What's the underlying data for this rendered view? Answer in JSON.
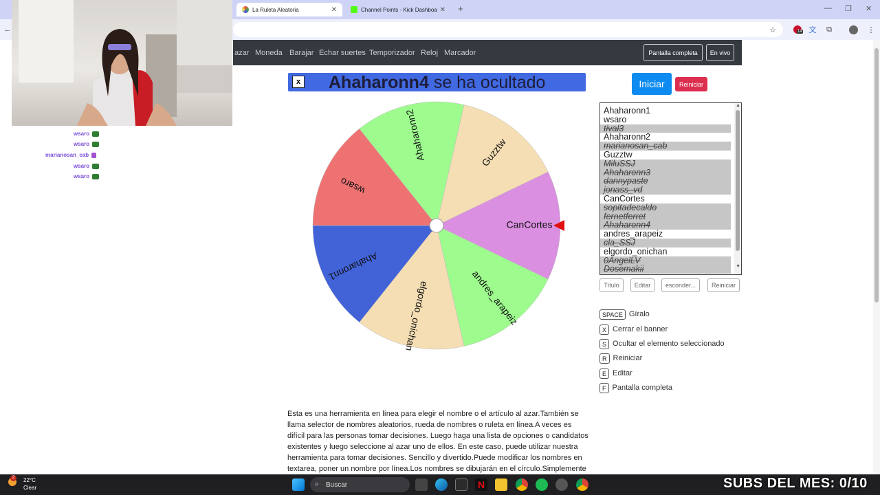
{
  "browser": {
    "tabs": [
      {
        "title": "La Ruleta Aleatoria",
        "active": true
      },
      {
        "title": "Channel Points - Kick Dashboa",
        "active": false
      }
    ],
    "new_tab": "+",
    "profile_badge": "14"
  },
  "navbar": {
    "links": [
      "azar",
      "Moneda",
      "Barajar",
      "Echar suertes",
      "Temporizador",
      "Reloj",
      "Marcador"
    ],
    "fullscreen_label": "Pantalla completa",
    "live_label": "En vivo"
  },
  "chat": [
    {
      "user": "wsaro"
    },
    {
      "user": "wsaro"
    },
    {
      "user": "marianosan_cab"
    },
    {
      "user": "wsaro"
    },
    {
      "user": "wsaro"
    }
  ],
  "banner": {
    "close_label": "x",
    "name": "Ahaharonn4",
    "message": "se ha ocultado"
  },
  "controls": {
    "start_label": "Iniciar",
    "reset_label": "Reiniciar"
  },
  "names": [
    {
      "name": "Ahaharonn1",
      "hidden": false
    },
    {
      "name": "wsaro",
      "hidden": false
    },
    {
      "name": "tival3",
      "hidden": true
    },
    {
      "name": "Ahaharonn2",
      "hidden": false
    },
    {
      "name": "marianosan_cab",
      "hidden": true
    },
    {
      "name": "Guzztw",
      "hidden": false
    },
    {
      "name": "MiluSSJ",
      "hidden": true
    },
    {
      "name": "Ahaharonn3",
      "hidden": true
    },
    {
      "name": "dannypaste",
      "hidden": true
    },
    {
      "name": "jonass_vd",
      "hidden": true
    },
    {
      "name": "CanCortes",
      "hidden": false
    },
    {
      "name": "sopitadecaldo",
      "hidden": true
    },
    {
      "name": "fernetferret",
      "hidden": true
    },
    {
      "name": "Ahaharonn4",
      "hidden": true
    },
    {
      "name": "andres_arapeiz",
      "hidden": false
    },
    {
      "name": "cla_SSJ",
      "hidden": true
    },
    {
      "name": "elgordo_onichan",
      "hidden": false
    },
    {
      "name": "0AngelLV",
      "hidden": true
    },
    {
      "name": "Dosemakii",
      "hidden": true
    }
  ],
  "list_buttons": {
    "title": "Título",
    "edit": "Editar",
    "hide": "esconder...",
    "reset": "Reiniciar"
  },
  "wheel": {
    "segments": [
      {
        "label": "CanCortes",
        "color": "#da8fe0"
      },
      {
        "label": "andres_arapeiz",
        "color": "#9efc8f"
      },
      {
        "label": "elgordo_onichan",
        "color": "#f5deb3"
      },
      {
        "label": "Ahaharonn1",
        "color": "#4263d8"
      },
      {
        "label": "wsaro",
        "color": "#ee7272"
      },
      {
        "label": "Ahaharonn2",
        "color": "#9efc8f"
      },
      {
        "label": "Guzztw",
        "color": "#f5deb3"
      }
    ],
    "pointer_color": "#e01010"
  },
  "shortcuts": [
    {
      "key": "SPACE",
      "label": "Gíralo"
    },
    {
      "key": "X",
      "label": "Cerrar el banner"
    },
    {
      "key": "S",
      "label": "Ocultar el elemento seleccionado"
    },
    {
      "key": "R",
      "label": "Reiniciar"
    },
    {
      "key": "E",
      "label": "Editar"
    },
    {
      "key": "F",
      "label": "Pantalla completa"
    }
  ],
  "description": "Esta es una herramienta en línea para elegir el nombre o el artículo al azar.También se llama selector de nombres aleatorios, rueda de nombres o ruleta en línea.A veces es difícil para las personas tomar decisiones. Luego haga una lista de opciones o candidatos existentes y luego seleccione al azar uno de ellos. En este caso, puede utilizar nuestra herramienta para tomar decisiones. Sencillo y divertido.Puede modificar los nombres en textarea, poner un nombre por línea.Los nombres se dibujarán en el círculo.Simplemente haga clic en la rueda",
  "taskbar": {
    "temperature": "22°C",
    "condition": "Clear",
    "search_placeholder": "Buscar",
    "notification_count": "2"
  },
  "overlay": {
    "subs_text": "SUBS DEL MES: 0/10"
  }
}
